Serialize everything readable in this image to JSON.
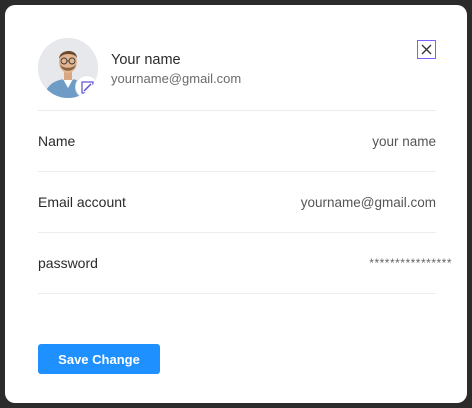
{
  "profile": {
    "name": "Your name",
    "email": "yourname@gmail.com",
    "avatar_icon": "user-avatar-photo",
    "edit_icon": "edit-image-icon"
  },
  "fields": [
    {
      "label": "Name",
      "value": "your name"
    },
    {
      "label": "Email account",
      "value": "yourname@gmail.com"
    },
    {
      "label": "password",
      "value": "****************"
    }
  ],
  "actions": {
    "save_label": "Save Change",
    "close_icon": "close-icon"
  },
  "colors": {
    "accent": "#1e90ff",
    "close_border": "#7b61ff",
    "divider": "#ececec",
    "background": "#2b2b2b",
    "card": "#ffffff"
  }
}
